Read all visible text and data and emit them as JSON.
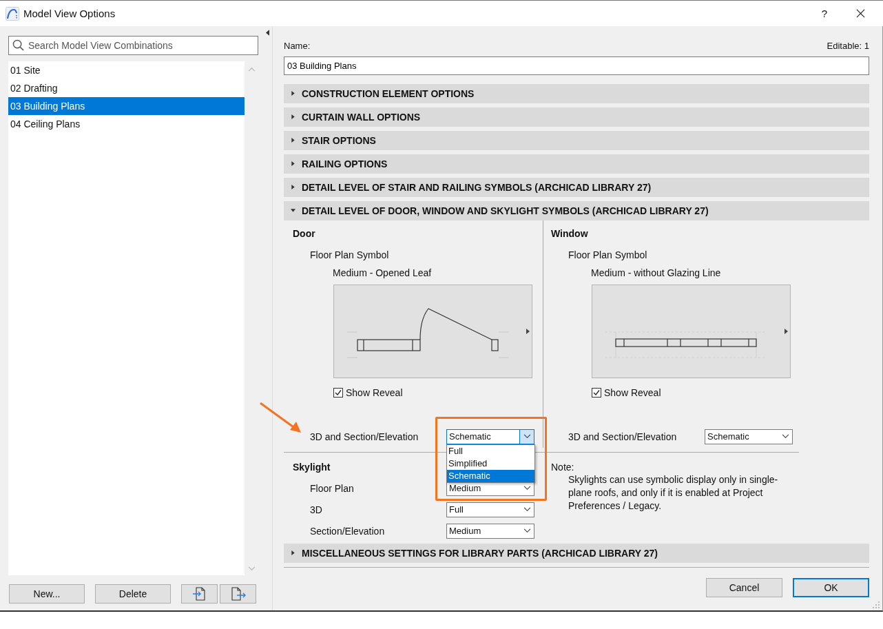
{
  "window": {
    "title": "Model View Options",
    "help": "?"
  },
  "search": {
    "placeholder": "Search Model View Combinations"
  },
  "combinations": [
    {
      "label": "01 Site",
      "selected": false
    },
    {
      "label": "02 Drafting",
      "selected": false
    },
    {
      "label": "03 Building Plans",
      "selected": true
    },
    {
      "label": "04 Ceiling Plans",
      "selected": false
    }
  ],
  "left_buttons": [
    {
      "kind": "text",
      "label": "New..."
    },
    {
      "kind": "text",
      "label": "Delete"
    },
    {
      "kind": "import"
    },
    {
      "kind": "export"
    }
  ],
  "name": {
    "label": "Name:",
    "editable": "Editable: 1",
    "value": "03 Building Plans"
  },
  "sections": [
    {
      "title": "CONSTRUCTION ELEMENT OPTIONS",
      "expanded": false
    },
    {
      "title": "CURTAIN WALL OPTIONS",
      "expanded": false
    },
    {
      "title": "STAIR OPTIONS",
      "expanded": false
    },
    {
      "title": "RAILING OPTIONS",
      "expanded": false
    },
    {
      "title": "DETAIL LEVEL OF STAIR AND RAILING SYMBOLS (ARCHICAD LIBRARY 27)",
      "expanded": false
    },
    {
      "title": "DETAIL LEVEL OF DOOR, WINDOW AND SKYLIGHT SYMBOLS (ARCHICAD LIBRARY 27)",
      "expanded": true
    },
    {
      "title": "MISCELLANEOUS SETTINGS FOR LIBRARY PARTS (ARCHICAD LIBRARY 27)",
      "expanded": false
    }
  ],
  "columns": [
    {
      "kind": "door",
      "heading": "Door",
      "symbol_label": "Floor Plan Symbol",
      "symbol_name": "Medium - Opened Leaf",
      "show_reveal": {
        "label": "Show Reveal",
        "checked": true
      },
      "section_label": "3D and Section/Elevation",
      "section_value": "Schematic",
      "dropdown_open": true,
      "options": [
        {
          "label": "Full",
          "selected": false
        },
        {
          "label": "Simplified",
          "selected": false
        },
        {
          "label": "Schematic",
          "selected": true
        }
      ]
    },
    {
      "kind": "window",
      "heading": "Window",
      "symbol_label": "Floor Plan Symbol",
      "symbol_name": "Medium - without Glazing Line",
      "show_reveal": {
        "label": "Show Reveal",
        "checked": true
      },
      "section_label": "3D and Section/Elevation",
      "section_value": "Schematic",
      "dropdown_open": false
    }
  ],
  "skylight": {
    "heading": "Skylight",
    "rows": [
      {
        "label": "Floor Plan",
        "value": "Medium"
      },
      {
        "label": "3D",
        "value": "Full"
      },
      {
        "label": "Section/Elevation",
        "value": "Medium"
      }
    ]
  },
  "note": {
    "label": "Note:",
    "text": "Skylights can use symbolic display only in single-plane roofs, and only if it is enabled at Project Preferences / Legacy."
  },
  "footer_buttons": [
    {
      "label": "Cancel",
      "default": false
    },
    {
      "label": "OK",
      "default": true
    }
  ]
}
